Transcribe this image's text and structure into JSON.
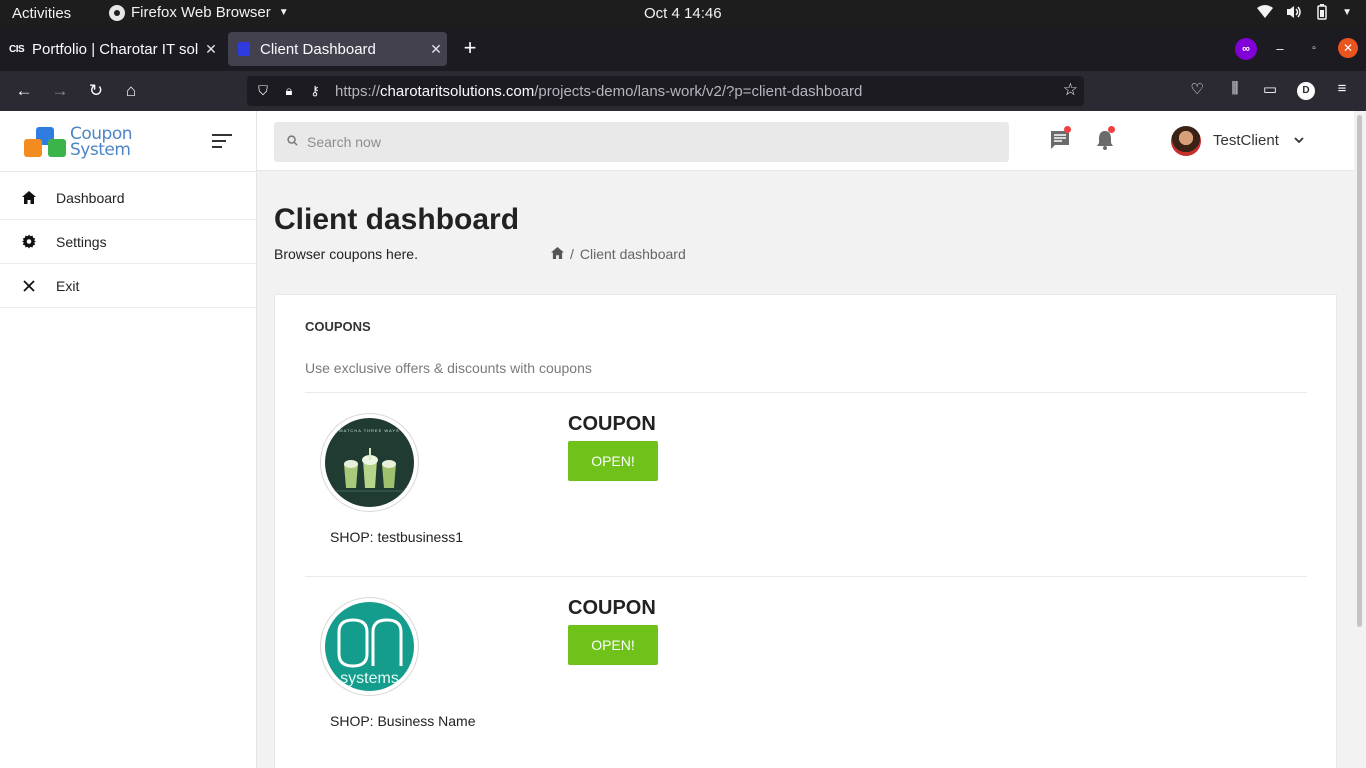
{
  "system": {
    "activities": "Activities",
    "app_name": "Firefox Web Browser",
    "clock": "Oct 4  14:46"
  },
  "browser": {
    "tabs": [
      {
        "title": "Portfolio | Charotar IT sol",
        "favicon": "CIS",
        "active": false
      },
      {
        "title": "Client Dashboard",
        "active": true
      }
    ],
    "url_scheme": "https://",
    "url_domain": "charotaritsolutions.com",
    "url_path": "/projects-demo/lans-work/v2/?p=client-dashboard",
    "account_initial": "D",
    "private_badge": "∞"
  },
  "app": {
    "logo_line1": "Coupon",
    "logo_line2": "System",
    "sidebar": {
      "items": [
        {
          "label": "Dashboard",
          "icon": "home-icon"
        },
        {
          "label": "Settings",
          "icon": "gear-icon"
        },
        {
          "label": "Exit",
          "icon": "close-icon"
        }
      ]
    },
    "header": {
      "search_placeholder": "Search now",
      "user_name": "TestClient"
    },
    "page": {
      "title": "Client dashboard",
      "subtitle": "Browser coupons here.",
      "breadcrumb_current": "Client dashboard"
    },
    "coupons_card": {
      "title": "COUPONS",
      "description": "Use exclusive offers & discounts with coupons",
      "items": [
        {
          "label": "COUPON",
          "button": "OPEN!",
          "shop": "SHOP: testbusiness1",
          "image_text": "MATCHA THREE WAYS"
        },
        {
          "label": "COUPON",
          "button": "OPEN!",
          "shop": "SHOP: Business Name",
          "image_text": "systems"
        }
      ]
    }
  },
  "colors": {
    "accent_green": "#6fc21a",
    "logo_blue": "#4d86c6",
    "notification_red": "#ef3f3f"
  }
}
